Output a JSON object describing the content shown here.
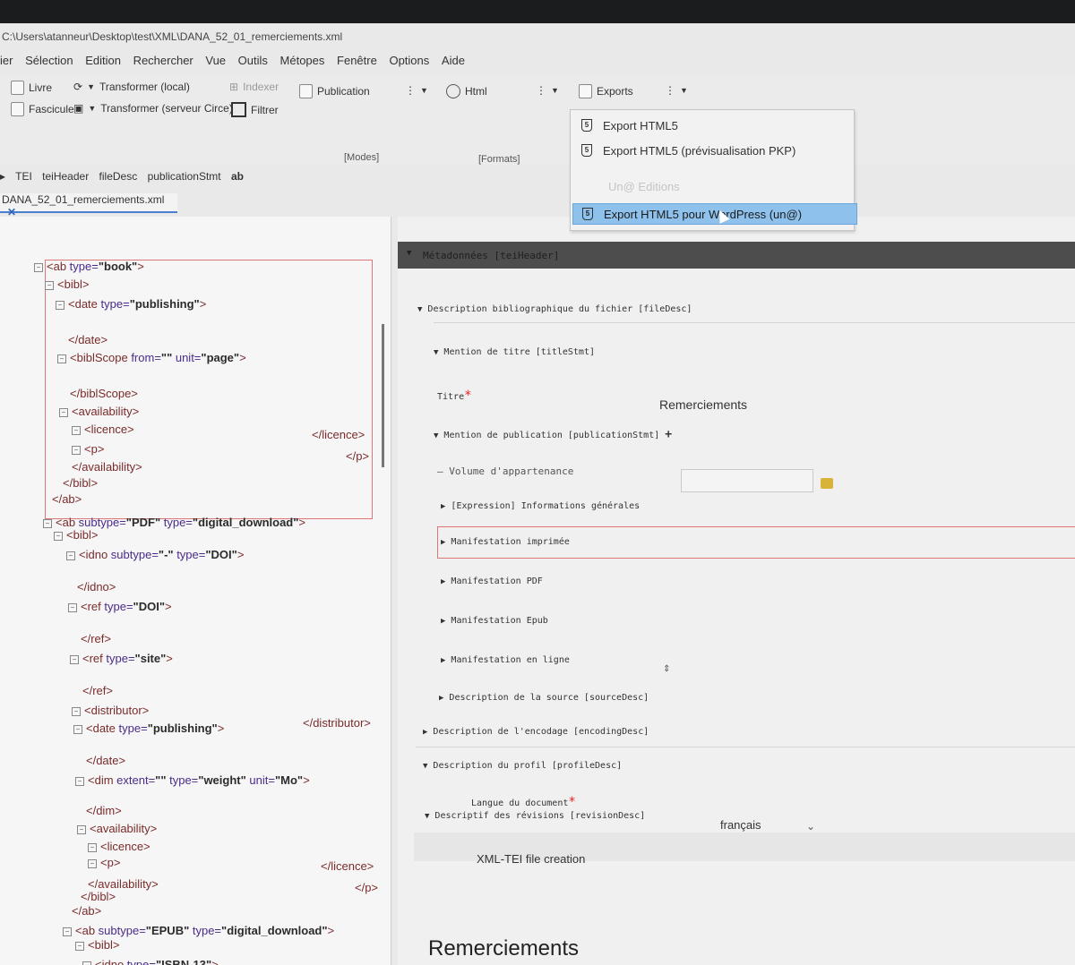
{
  "window": {
    "title": "C:\\Users\\atanneur\\Desktop\\test\\XML\\DANA_52_01_remerciements.xml"
  },
  "menu": [
    "ier",
    "Sélection",
    "Edition",
    "Rechercher",
    "Vue",
    "Outils",
    "Métopes",
    "Fenêtre",
    "Options",
    "Aide"
  ],
  "toolbar": {
    "livre": "Livre",
    "fascicule": "Fascicule",
    "transformer_local": "Transformer (local)",
    "transformer_serveur": "Transformer (serveur Circe)",
    "indexer": "Indexer",
    "filtrer": "Filtrer",
    "publication": "Publication",
    "html": "Html",
    "exports": "Exports",
    "modes_label": "[Modes]",
    "formats_label": "[Formats]"
  },
  "breadcrumb": [
    "TEI",
    "teiHeader",
    "fileDesc",
    "publicationStmt",
    "ab"
  ],
  "file_tab": {
    "name": "DANA_52_01_remerciements.xml",
    "close": "✕"
  },
  "exports_menu": {
    "items": [
      {
        "label": "Export HTML5"
      },
      {
        "label": "Export HTML5 (prévisualisation PKP)"
      },
      {
        "label": "Un@ Editions"
      },
      {
        "label": "Export HTML5 pour WordPress (un@)"
      }
    ]
  },
  "code": {
    "lines": [
      {
        "open": "<ab ",
        "attrs": [
          [
            "type=",
            "\"book\""
          ]
        ],
        "close": ">"
      },
      {
        "open": "<bibl>",
        "attrs": [],
        "close": ""
      },
      {
        "open": "<date ",
        "attrs": [
          [
            "type=",
            "\"publishing\""
          ]
        ],
        "close": ">"
      },
      {
        "open": "</date>",
        "attrs": [],
        "close": ""
      },
      {
        "open": "<biblScope ",
        "attrs": [
          [
            "from=",
            "\"\""
          ],
          [
            " unit=",
            "\"page\""
          ]
        ],
        "close": ">"
      },
      {
        "open": "</biblScope>",
        "attrs": [],
        "close": ""
      },
      {
        "open": "<availability>",
        "attrs": [],
        "close": ""
      },
      {
        "open": "<licence>",
        "attrs": [],
        "close": ""
      },
      {
        "open": "<p>",
        "attrs": [],
        "close": ""
      },
      {
        "open": "</availability>",
        "attrs": [],
        "close": ""
      },
      {
        "open": "</bibl>",
        "attrs": [],
        "close": ""
      },
      {
        "open": "</ab>",
        "attrs": [],
        "close": ""
      },
      {
        "open": "<ab ",
        "attrs": [
          [
            "subtype=",
            "\"PDF\""
          ],
          [
            " type=",
            "\"digital_download\""
          ]
        ],
        "close": ">"
      },
      {
        "open": "<bibl>",
        "attrs": [],
        "close": ""
      },
      {
        "open": "<idno ",
        "attrs": [
          [
            "subtype=",
            "\"-\""
          ],
          [
            " type=",
            "\"DOI\""
          ]
        ],
        "close": ">"
      },
      {
        "open": "</idno>",
        "attrs": [],
        "close": ""
      },
      {
        "open": "<ref ",
        "attrs": [
          [
            "type=",
            "\"DOI\""
          ]
        ],
        "close": ">"
      },
      {
        "open": "</ref>",
        "attrs": [],
        "close": ""
      },
      {
        "open": "<ref ",
        "attrs": [
          [
            "type=",
            "\"site\""
          ]
        ],
        "close": ">"
      },
      {
        "open": "</ref>",
        "attrs": [],
        "close": ""
      },
      {
        "open": "<distributor>",
        "attrs": [],
        "close": ""
      },
      {
        "open": "<date ",
        "attrs": [
          [
            "type=",
            "\"publishing\""
          ]
        ],
        "close": ">"
      },
      {
        "open": "</date>",
        "attrs": [],
        "close": ""
      },
      {
        "open": "<dim ",
        "attrs": [
          [
            "extent=",
            "\"\""
          ],
          [
            " type=",
            "\"weight\""
          ],
          [
            " unit=",
            "\"Mo\""
          ]
        ],
        "close": ">"
      },
      {
        "open": "</dim>",
        "attrs": [],
        "close": ""
      },
      {
        "open": "<availability>",
        "attrs": [],
        "close": ""
      },
      {
        "open": "<licence>",
        "attrs": [],
        "close": ""
      },
      {
        "open": "<p>",
        "attrs": [],
        "close": ""
      },
      {
        "open": "</availability>",
        "attrs": [],
        "close": ""
      },
      {
        "open": "</bibl>",
        "attrs": [],
        "close": ""
      },
      {
        "open": "</ab>",
        "attrs": [],
        "close": ""
      },
      {
        "open": "<ab ",
        "attrs": [
          [
            "subtype=",
            "\"EPUB\""
          ],
          [
            " type=",
            "\"digital_download\""
          ]
        ],
        "close": ">"
      },
      {
        "open": "<bibl>",
        "attrs": [],
        "close": ""
      },
      {
        "open": "<idno ",
        "attrs": [
          [
            "type=",
            "\"ISBN-13\""
          ]
        ],
        "close": ">"
      }
    ],
    "right_tags": [
      "</licence>",
      "</p>",
      "</distributor>",
      "</licence>",
      "</p>"
    ]
  },
  "form": {
    "header": "Métadonnées [teiHeader]",
    "file_desc": "Description bibliographique du fichier [fileDesc]",
    "title_stmt": "Mention de titre [titleStmt]",
    "titre_label": "Titre",
    "titre_value": "Remerciements",
    "publication_stmt": "Mention de publication [publicationStmt]",
    "plus": "+",
    "volume_label": "Volume d'appartenance",
    "expression": "[Expression] Informations générales",
    "manif_imprimee": "Manifestation imprimée",
    "manif_pdf": "Manifestation PDF",
    "manif_epub": "Manifestation Epub",
    "manif_en_ligne": "Manifestation en ligne",
    "source_desc": "Description de la source [sourceDesc]",
    "encoding_desc": "Description de l'encodage [encodingDesc]",
    "profile_desc": "Description du profil [profileDesc]",
    "langue_label": "Langue du document",
    "langue_value": "français",
    "revision_desc": "Descriptif des révisions [revisionDesc]",
    "revision_text": "XML-TEI file creation",
    "preview_title": "Remerciements",
    "required_mark": "*"
  }
}
